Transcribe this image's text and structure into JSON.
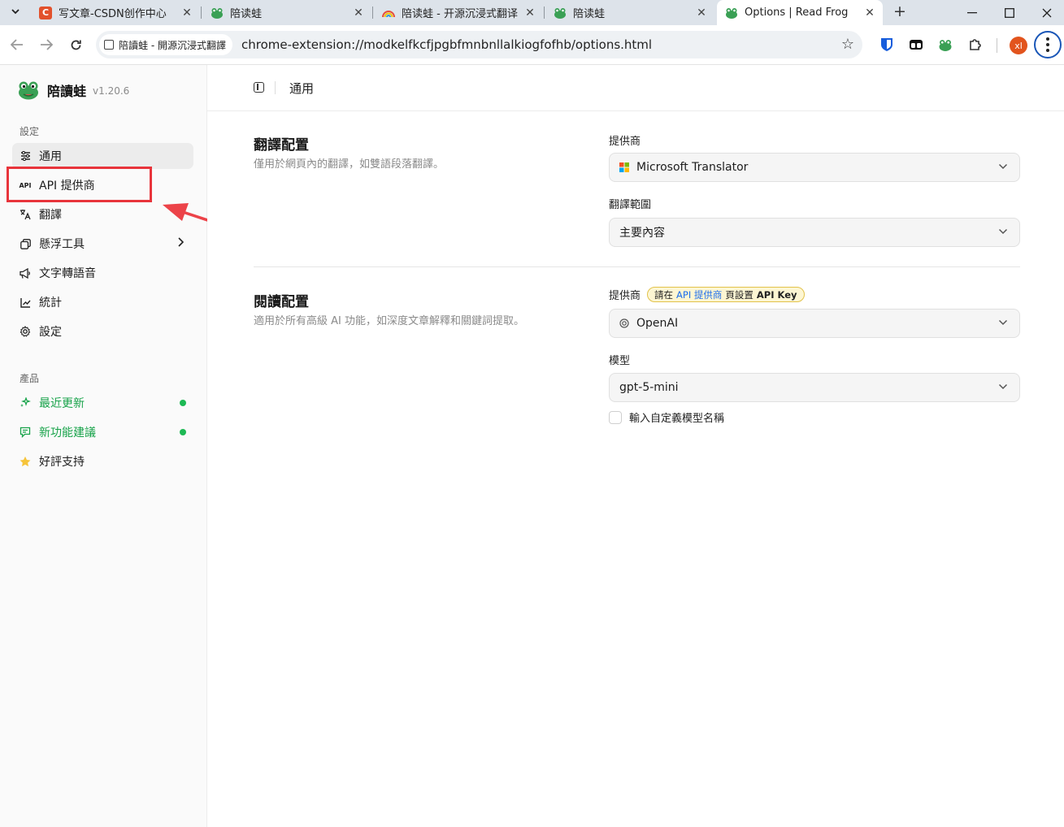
{
  "browser": {
    "tabs": [
      {
        "title": "写文章-CSDN创作中心"
      },
      {
        "title": "陪读蛙"
      },
      {
        "title": "陪读蛙 - 开源沉浸式翻译"
      },
      {
        "title": "陪读蛙"
      },
      {
        "title": "Options | Read Frog"
      }
    ],
    "site_chip": "陪讀蛙 - 開源沉浸式翻譯",
    "url": "chrome-extension://modkelfkcfjpgbfmnbnllalkiogfofhb/options.html",
    "profile_initials": "xl"
  },
  "sidebar": {
    "app_name": "陪讀蛙",
    "version": "v1.20.6",
    "settings_label": "設定",
    "items": [
      {
        "label": "通用",
        "icon": "sliders-icon"
      },
      {
        "label": "API 提供商",
        "icon": "api-icon"
      },
      {
        "label": "翻譯",
        "icon": "translate-icon"
      },
      {
        "label": "懸浮工具",
        "icon": "float-window-icon"
      },
      {
        "label": "文字轉語音",
        "icon": "megaphone-icon"
      },
      {
        "label": "統計",
        "icon": "chart-icon"
      },
      {
        "label": "設定",
        "icon": "gear-icon"
      }
    ],
    "product_label": "產品",
    "product_items": [
      {
        "label": "最近更新",
        "icon": "sparkle-icon"
      },
      {
        "label": "新功能建議",
        "icon": "feedback-icon"
      },
      {
        "label": "好評支持",
        "icon": "star-icon"
      }
    ]
  },
  "main": {
    "header_title": "通用",
    "translate_config": {
      "title": "翻譯配置",
      "desc": "僅用於網頁內的翻譯，如雙語段落翻譯。",
      "provider_label": "提供商",
      "provider_value": "Microsoft Translator",
      "range_label": "翻譯範圍",
      "range_value": "主要內容"
    },
    "read_config": {
      "title": "閱讀配置",
      "desc": "適用於所有高級 AI 功能，如深度文章解釋和關鍵詞提取。",
      "provider_label": "提供商",
      "badge_prefix": "請在",
      "badge_link": "API 提供商",
      "badge_mid": "頁設置",
      "badge_key": "API Key",
      "provider_value": "OpenAI",
      "model_label": "模型",
      "model_value": "gpt-5-mini",
      "custom_model_label": "輸入自定義模型名稱"
    }
  },
  "colors": {
    "highlight_box": "#e8343b",
    "accent_green": "#18a34a",
    "badge_bg": "#fdf6d3",
    "link_blue": "#1f6feb"
  }
}
